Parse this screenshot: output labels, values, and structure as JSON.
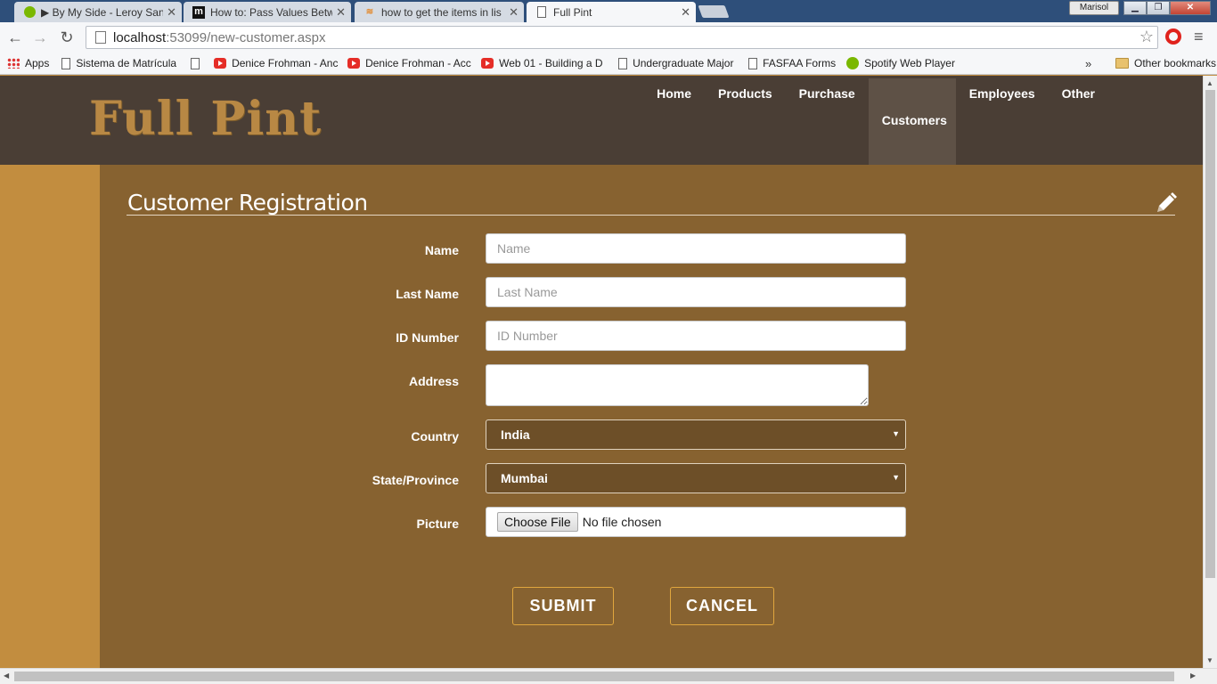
{
  "browser": {
    "tabs": [
      {
        "title": "▶ By My Side - Leroy San",
        "icon": "spotify-icon"
      },
      {
        "title": "How to: Pass Values Betw",
        "icon": "m-icon"
      },
      {
        "title": "how to get the items in lis",
        "icon": "stackoverflow-icon"
      },
      {
        "title": "Full Pint",
        "icon": "page-icon"
      }
    ],
    "user": "Marisol",
    "url_host": "localhost",
    "url_path": ":53099/new-customer.aspx",
    "bookmarks": [
      {
        "label": "Apps",
        "icon": "apps"
      },
      {
        "label": "Sistema de Matrícula",
        "icon": "doc"
      },
      {
        "label": "",
        "icon": "doc"
      },
      {
        "label": "Denice Frohman - Anc",
        "icon": "yt"
      },
      {
        "label": "Denice Frohman - Acc",
        "icon": "yt"
      },
      {
        "label": "Web 01 - Building a D",
        "icon": "yt"
      },
      {
        "label": "Undergraduate Major",
        "icon": "doc"
      },
      {
        "label": "FASFAA Forms",
        "icon": "doc"
      },
      {
        "label": "Spotify Web Player",
        "icon": "spot"
      }
    ],
    "bookmarks_more": "»",
    "other_bookmarks": "Other bookmarks"
  },
  "site": {
    "logo": "Full Pint",
    "nav": [
      "Home",
      "Products",
      "Purchase",
      "Customers",
      "Employees",
      "Other"
    ],
    "active_nav": "Customers"
  },
  "form": {
    "title": "Customer Registration",
    "fields": {
      "name": {
        "label": "Name",
        "placeholder": "Name",
        "value": ""
      },
      "last_name": {
        "label": "Last Name",
        "placeholder": "Last Name",
        "value": ""
      },
      "id_number": {
        "label": "ID Number",
        "placeholder": "ID Number",
        "value": ""
      },
      "address": {
        "label": "Address",
        "value": ""
      },
      "country": {
        "label": "Country",
        "value": "India"
      },
      "state": {
        "label": "State/Province",
        "value": "Mumbai"
      },
      "picture": {
        "label": "Picture",
        "button": "Choose File",
        "status": "No file chosen"
      }
    },
    "submit": "SUBMIT",
    "cancel": "CANCEL"
  },
  "colors": {
    "header": "#4a3e35",
    "content": "#876230",
    "background": "#c28d3f",
    "button_border": "#e0a63e"
  }
}
